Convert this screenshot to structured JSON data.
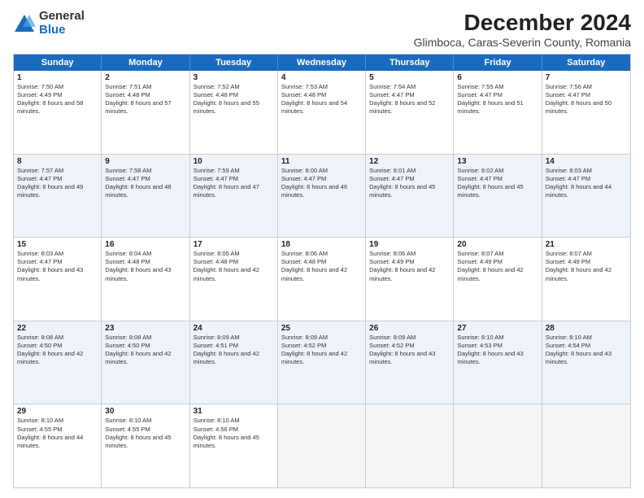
{
  "logo": {
    "general": "General",
    "blue": "Blue"
  },
  "title": "December 2024",
  "subtitle": "Glimboca, Caras-Severin County, Romania",
  "days": [
    "Sunday",
    "Monday",
    "Tuesday",
    "Wednesday",
    "Thursday",
    "Friday",
    "Saturday"
  ],
  "rows": [
    [
      {
        "day": "1",
        "sunrise": "7:50 AM",
        "sunset": "4:49 PM",
        "daylight": "8 hours and 58 minutes."
      },
      {
        "day": "2",
        "sunrise": "7:51 AM",
        "sunset": "4:48 PM",
        "daylight": "8 hours and 57 minutes."
      },
      {
        "day": "3",
        "sunrise": "7:52 AM",
        "sunset": "4:48 PM",
        "daylight": "8 hours and 55 minutes."
      },
      {
        "day": "4",
        "sunrise": "7:53 AM",
        "sunset": "4:48 PM",
        "daylight": "8 hours and 54 minutes."
      },
      {
        "day": "5",
        "sunrise": "7:54 AM",
        "sunset": "4:47 PM",
        "daylight": "8 hours and 52 minutes."
      },
      {
        "day": "6",
        "sunrise": "7:55 AM",
        "sunset": "4:47 PM",
        "daylight": "8 hours and 51 minutes."
      },
      {
        "day": "7",
        "sunrise": "7:56 AM",
        "sunset": "4:47 PM",
        "daylight": "8 hours and 50 minutes."
      }
    ],
    [
      {
        "day": "8",
        "sunrise": "7:57 AM",
        "sunset": "4:47 PM",
        "daylight": "8 hours and 49 minutes."
      },
      {
        "day": "9",
        "sunrise": "7:58 AM",
        "sunset": "4:47 PM",
        "daylight": "8 hours and 48 minutes."
      },
      {
        "day": "10",
        "sunrise": "7:59 AM",
        "sunset": "4:47 PM",
        "daylight": "8 hours and 47 minutes."
      },
      {
        "day": "11",
        "sunrise": "8:00 AM",
        "sunset": "4:47 PM",
        "daylight": "8 hours and 46 minutes."
      },
      {
        "day": "12",
        "sunrise": "8:01 AM",
        "sunset": "4:47 PM",
        "daylight": "8 hours and 45 minutes."
      },
      {
        "day": "13",
        "sunrise": "8:02 AM",
        "sunset": "4:47 PM",
        "daylight": "8 hours and 45 minutes."
      },
      {
        "day": "14",
        "sunrise": "8:03 AM",
        "sunset": "4:47 PM",
        "daylight": "8 hours and 44 minutes."
      }
    ],
    [
      {
        "day": "15",
        "sunrise": "8:03 AM",
        "sunset": "4:47 PM",
        "daylight": "8 hours and 43 minutes."
      },
      {
        "day": "16",
        "sunrise": "8:04 AM",
        "sunset": "4:48 PM",
        "daylight": "8 hours and 43 minutes."
      },
      {
        "day": "17",
        "sunrise": "8:05 AM",
        "sunset": "4:48 PM",
        "daylight": "8 hours and 42 minutes."
      },
      {
        "day": "18",
        "sunrise": "8:06 AM",
        "sunset": "4:48 PM",
        "daylight": "8 hours and 42 minutes."
      },
      {
        "day": "19",
        "sunrise": "8:06 AM",
        "sunset": "4:49 PM",
        "daylight": "8 hours and 42 minutes."
      },
      {
        "day": "20",
        "sunrise": "8:07 AM",
        "sunset": "4:49 PM",
        "daylight": "8 hours and 42 minutes."
      },
      {
        "day": "21",
        "sunrise": "8:07 AM",
        "sunset": "4:49 PM",
        "daylight": "8 hours and 42 minutes."
      }
    ],
    [
      {
        "day": "22",
        "sunrise": "8:08 AM",
        "sunset": "4:50 PM",
        "daylight": "8 hours and 42 minutes."
      },
      {
        "day": "23",
        "sunrise": "8:08 AM",
        "sunset": "4:50 PM",
        "daylight": "8 hours and 42 minutes."
      },
      {
        "day": "24",
        "sunrise": "8:09 AM",
        "sunset": "4:51 PM",
        "daylight": "8 hours and 42 minutes."
      },
      {
        "day": "25",
        "sunrise": "8:09 AM",
        "sunset": "4:52 PM",
        "daylight": "8 hours and 42 minutes."
      },
      {
        "day": "26",
        "sunrise": "8:09 AM",
        "sunset": "4:52 PM",
        "daylight": "8 hours and 43 minutes."
      },
      {
        "day": "27",
        "sunrise": "8:10 AM",
        "sunset": "4:53 PM",
        "daylight": "8 hours and 43 minutes."
      },
      {
        "day": "28",
        "sunrise": "8:10 AM",
        "sunset": "4:54 PM",
        "daylight": "8 hours and 43 minutes."
      }
    ],
    [
      {
        "day": "29",
        "sunrise": "8:10 AM",
        "sunset": "4:55 PM",
        "daylight": "8 hours and 44 minutes."
      },
      {
        "day": "30",
        "sunrise": "8:10 AM",
        "sunset": "4:55 PM",
        "daylight": "8 hours and 45 minutes."
      },
      {
        "day": "31",
        "sunrise": "8:10 AM",
        "sunset": "4:56 PM",
        "daylight": "8 hours and 45 minutes."
      },
      null,
      null,
      null,
      null
    ]
  ]
}
